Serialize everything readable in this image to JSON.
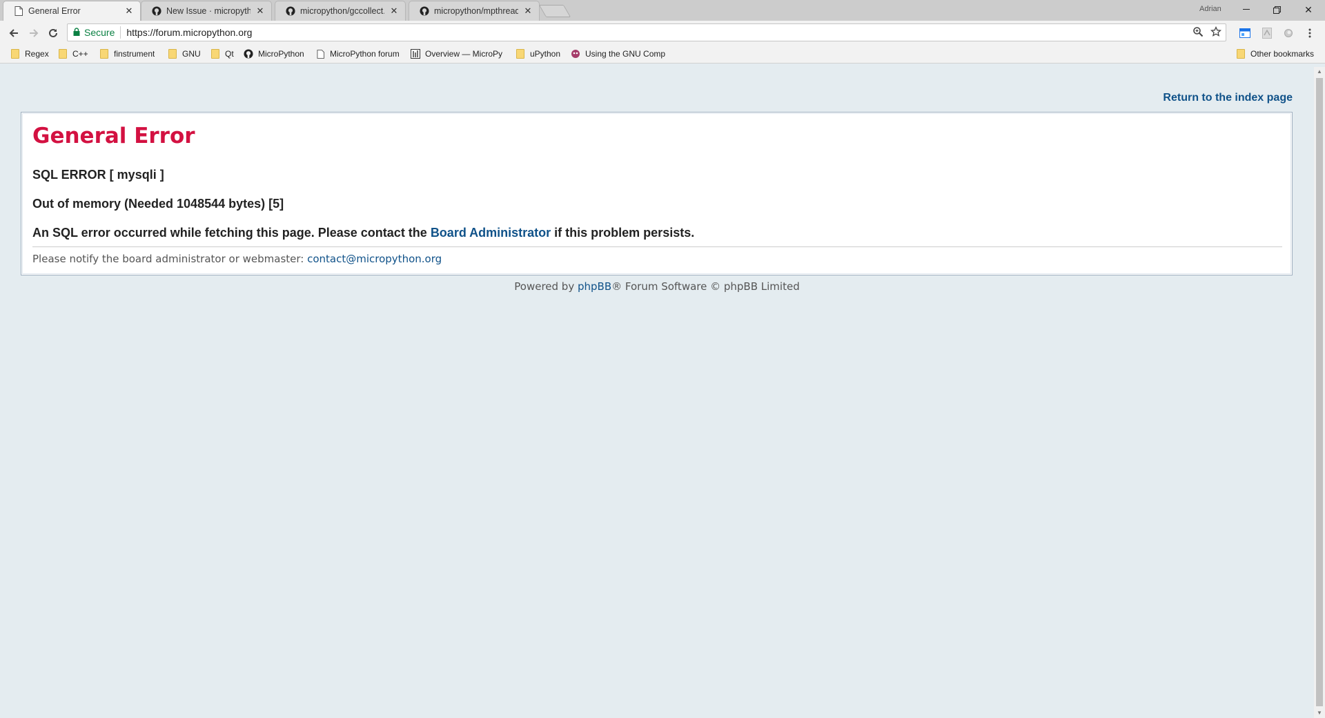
{
  "tabs": [
    {
      "title": "General Error",
      "icon": "page-icon",
      "active": true
    },
    {
      "title": "New Issue · micropython",
      "icon": "github-icon",
      "active": false
    },
    {
      "title": "micropython/gccollect.c",
      "icon": "github-icon",
      "active": false
    },
    {
      "title": "micropython/mpthreadp",
      "icon": "github-icon",
      "active": false
    }
  ],
  "window": {
    "user": "Adrian"
  },
  "omnibox": {
    "secure_label": "Secure",
    "url": "https://forum.micropython.org"
  },
  "bookmarks": [
    {
      "label": "Regex",
      "icon": "folder-icon"
    },
    {
      "label": "C++",
      "icon": "folder-icon"
    },
    {
      "label": "finstrument",
      "icon": "folder-icon"
    },
    {
      "label": "GNU",
      "icon": "folder-icon"
    },
    {
      "label": "Qt",
      "icon": "folder-icon"
    },
    {
      "label": "MicroPython",
      "icon": "github-icon"
    },
    {
      "label": "MicroPython forum",
      "icon": "page-icon"
    },
    {
      "label": "Overview — MicroPy",
      "icon": "chart-icon"
    },
    {
      "label": "uPython",
      "icon": "folder-icon"
    },
    {
      "label": "Using the GNU Comp",
      "icon": "gnu-icon"
    },
    {
      "label": "Other bookmarks",
      "icon": "folder-icon"
    }
  ],
  "page": {
    "return_link": "Return to the index page",
    "title": "General Error",
    "sql_error": "SQL ERROR [ mysqli ]",
    "memory_error": "Out of memory (Needed 1048544 bytes) [5]",
    "message_before": "An SQL error occurred while fetching this page. Please contact the ",
    "message_link": "Board Administrator",
    "message_after": " if this problem persists.",
    "notify_text": "Please notify the board administrator or webmaster: ",
    "notify_email": "contact@micropython.org",
    "footer_before": "Powered by ",
    "footer_link": "phpBB",
    "footer_after": "® Forum Software © phpBB Limited"
  },
  "colors": {
    "title": "#d31141",
    "link": "#105289",
    "background": "#e4ecf0"
  }
}
